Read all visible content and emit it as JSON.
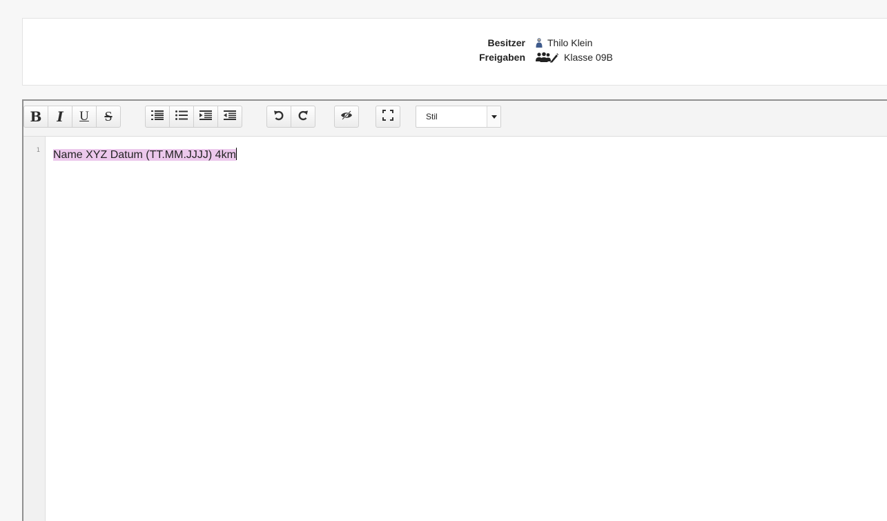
{
  "meta": {
    "owner_label": "Besitzer",
    "owner_name": "Thilo Klein",
    "shares_label": "Freigaben",
    "shares_name": "Klasse 09B",
    "owner_icon": "person-icon",
    "shares_icon": "group-edit-icon"
  },
  "toolbar": {
    "bold": "B",
    "italic": "I",
    "underline": "U",
    "strikethrough": "S",
    "icons": [
      "ordered-list-icon",
      "unordered-list-icon",
      "indent-icon",
      "outdent-icon",
      "undo-icon",
      "redo-icon",
      "preview-toggle-icon",
      "fullscreen-icon"
    ],
    "style_select": {
      "value": "Stil"
    }
  },
  "editor": {
    "line_numbers": [
      "1"
    ],
    "lines": [
      "Name XYZ Datum (TT.MM.JJJJ) 4km"
    ],
    "highlight_color": "#ecc8ec"
  }
}
